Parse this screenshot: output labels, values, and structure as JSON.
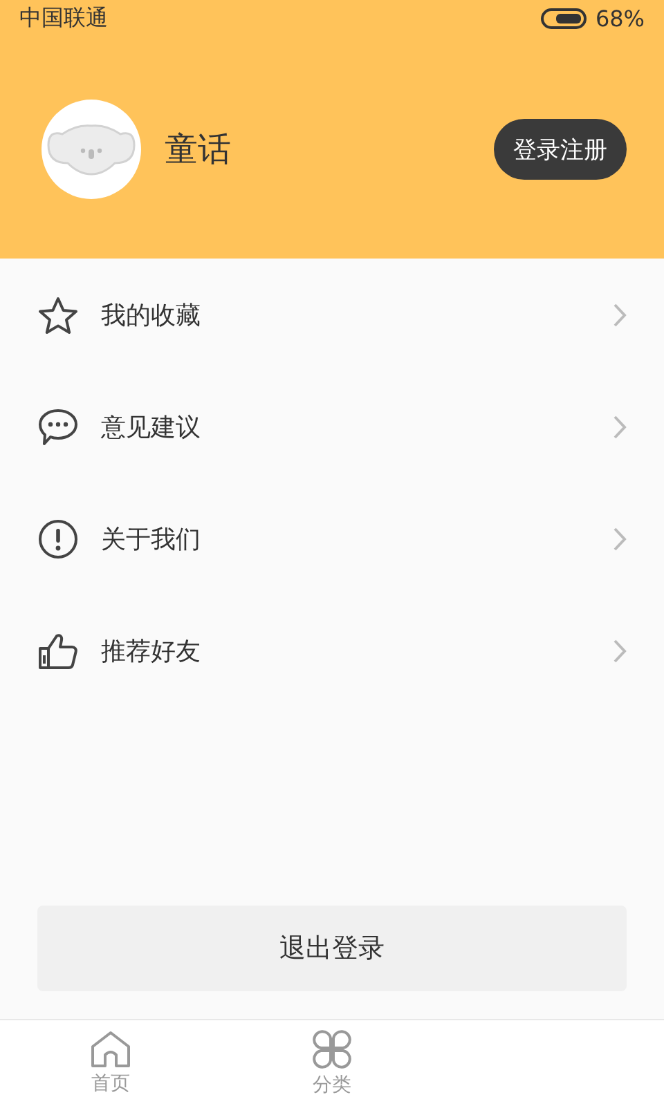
{
  "status_bar": {
    "carrier": "中国联通",
    "battery": "68%"
  },
  "profile": {
    "name": "童话",
    "login_button": "登录注册"
  },
  "menu": [
    {
      "kind": "star",
      "label": "我的收藏"
    },
    {
      "kind": "chat",
      "label": "意见建议"
    },
    {
      "kind": "info",
      "label": "关于我们"
    },
    {
      "kind": "thumb",
      "label": "推荐好友"
    }
  ],
  "logout_button": "退出登录",
  "tabs": [
    {
      "kind": "home",
      "label": "首页",
      "selected": false
    },
    {
      "kind": "grid",
      "label": "分类",
      "selected": false
    }
  ]
}
